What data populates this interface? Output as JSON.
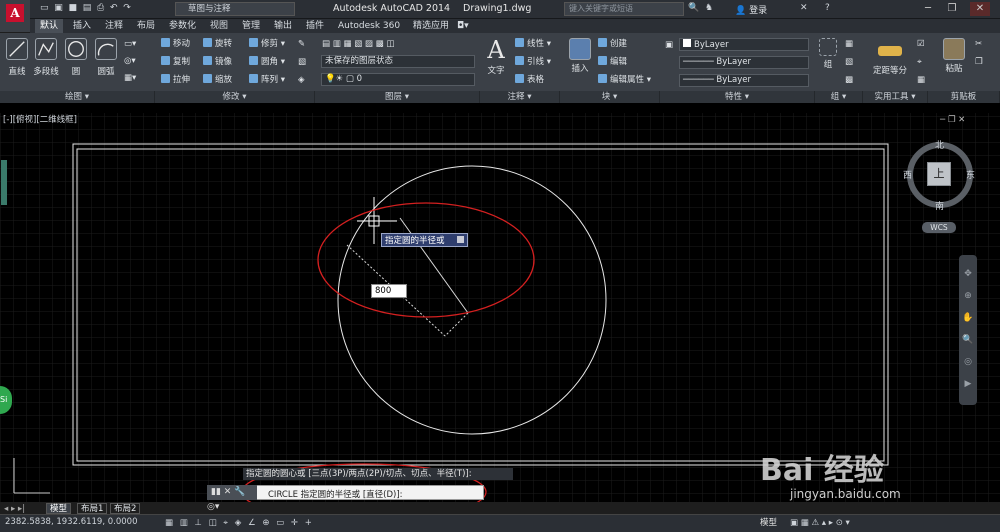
{
  "titlebar": {
    "workspace": "草图与注释",
    "app_title": "Autodesk AutoCAD 2014",
    "doc_title": "Drawing1.dwg",
    "search_placeholder": "键入关键字或短语",
    "login": "登录"
  },
  "tabs": [
    "默认",
    "插入",
    "注释",
    "布局",
    "参数化",
    "视图",
    "管理",
    "输出",
    "插件",
    "Autodesk 360",
    "精选应用"
  ],
  "ribbon": {
    "draw": {
      "title": "绘图",
      "line": "直线",
      "polyline": "多段线",
      "circle": "圆",
      "arc": "圆弧"
    },
    "modify": {
      "title": "修改",
      "move": "移动",
      "rotate": "旋转",
      "trim": "修剪",
      "copy": "复制",
      "mirror": "镜像",
      "fillet": "圆角",
      "stretch": "拉伸",
      "scale": "缩放",
      "array": "阵列"
    },
    "layers": {
      "title": "图层",
      "state": "未保存的图层状态",
      "current": "0"
    },
    "annotation": {
      "title": "注释",
      "text": "文字",
      "linear": "线性",
      "leader": "引线",
      "table": "表格"
    },
    "block": {
      "title": "块",
      "insert": "插入",
      "create": "创建",
      "edit": "编辑",
      "edit_attr": "编辑属性"
    },
    "properties": {
      "title": "特性",
      "color": "ByLayer",
      "linetype": "ByLayer",
      "lineweight": "ByLayer"
    },
    "groups": {
      "title": "组",
      "group": "组"
    },
    "utilities": {
      "title": "实用工具",
      "measure": "定距等分"
    },
    "clipboard": {
      "title": "剪贴板",
      "paste": "粘贴"
    }
  },
  "viewport": {
    "label": "[-][俯视][二维线框]",
    "tooltip": "指定圆的半径或",
    "dynamic_input": "800"
  },
  "viewcube": {
    "north": "北",
    "south": "南",
    "east": "东",
    "west": "西",
    "top": "上",
    "wcs": "WCS"
  },
  "command": {
    "history": "指定圆的圆心或 [三点(3P)/两点(2P)/切点、切点、半径(T)]:",
    "prompt": "CIRCLE 指定圆的半径或 [直径(D)]:"
  },
  "layout_tabs": [
    "模型",
    "布局1",
    "布局2"
  ],
  "status": {
    "coords": "2382.5838, 1932.6119, 0.0000",
    "model": "模型"
  },
  "watermark": {
    "main": "Bai 经验",
    "sub": "jingyan.baidu.com"
  },
  "side_badge": "Si",
  "colors": {
    "highlight_ellipse": "#d42020",
    "canvas": "#000000"
  }
}
